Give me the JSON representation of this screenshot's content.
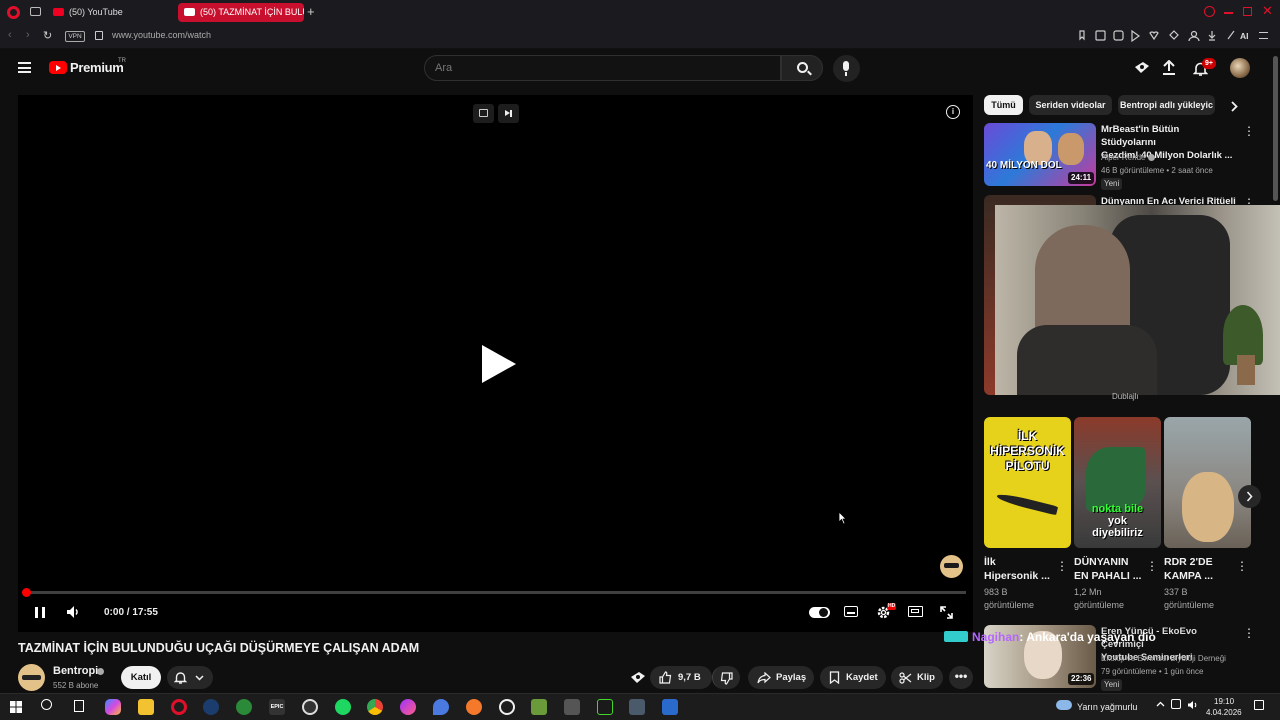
{
  "browser": {
    "tabs": [
      {
        "label": "(50) YouTube",
        "active": false
      },
      {
        "label": "(50) TAZMİNAT İÇİN BULU",
        "active": true
      }
    ],
    "vpn_label": "VPN",
    "url": "www.youtube.com/watch",
    "ai_label": "AI"
  },
  "header": {
    "logo_text": "Premium",
    "region": "TR",
    "search_placeholder": "Ara",
    "notif_count": "9+"
  },
  "player": {
    "time": "0:00 / 17:55",
    "progress_fraction": 0.004,
    "hd_badge": "HD"
  },
  "video": {
    "title": "TAZMİNAT İÇİN BULUNDUĞU UÇAĞI DÜŞÜRMEYE ÇALIŞAN ADAM",
    "channel": "Bentropi",
    "subscribers": "552 B abone",
    "join_label": "Katıl",
    "likes": "9,7 B",
    "share_label": "Paylaş",
    "save_label": "Kaydet",
    "clip_label": "Klip"
  },
  "sidebar": {
    "chips": [
      "Tümü",
      "Seriden videolar",
      "Bentropi adlı yükleyic"
    ],
    "videos": [
      {
        "title_line1": "MrBeast'in Bütün Stüdyolarını",
        "title_line2": "Gezdim! 40 Milyon Dolarlık ...",
        "channel": "Alper Rende",
        "meta": "46 B görüntüleme • 2 saat önce",
        "badge": "Yeni",
        "duration": "24:11",
        "thumb_text": "40 MİLYON DOL"
      },
      {
        "title_line1": "Dünyanın En Acı Verici Ritüeli |",
        "dub_label": "Dublajlı"
      }
    ],
    "shorts": [
      {
        "title_line1": "İlk",
        "title_line2": "Hipersonik ...",
        "views": "983 B",
        "views_label": "görüntüleme",
        "thumb_text": "İLK HİPERSONİK PİLOTU"
      },
      {
        "title_line1": "DÜNYANIN",
        "title_line2": "EN PAHALI ...",
        "views": "1,2 Mn",
        "views_label": "görüntüleme",
        "thumb_text_1": "nokta bile",
        "thumb_text_2": "yok",
        "thumb_text_3": "diyebiliriz"
      },
      {
        "title_line1": "RDR 2'DE",
        "title_line2": "KAMPA ...",
        "views": "337 B",
        "views_label": "görüntüleme"
      }
    ],
    "bottom_video": {
      "title_line1": "Eren Yüncü - EkoEvo Çevrimiçi",
      "title_line2": "Youtube Seminerleri",
      "channel": "Ekoloji ve Evrimsel Biyoloji Derneği",
      "meta": "79 görüntüleme • 1 gün önce",
      "badge": "Yeni",
      "duration": "22:36"
    }
  },
  "chat_overlay": {
    "user": "Nagihan",
    "message": ": Ankara'da yaşayan dio"
  },
  "taskbar": {
    "weather": "Yarın yağmurlu",
    "time": "19:10",
    "date": "4.04.2026",
    "epic_label": "EPIC"
  },
  "colors": {
    "yt_red": "#ff0000",
    "background": "#0f0f0f",
    "chip_bg": "#272727",
    "opera_red": "#e0102a"
  }
}
